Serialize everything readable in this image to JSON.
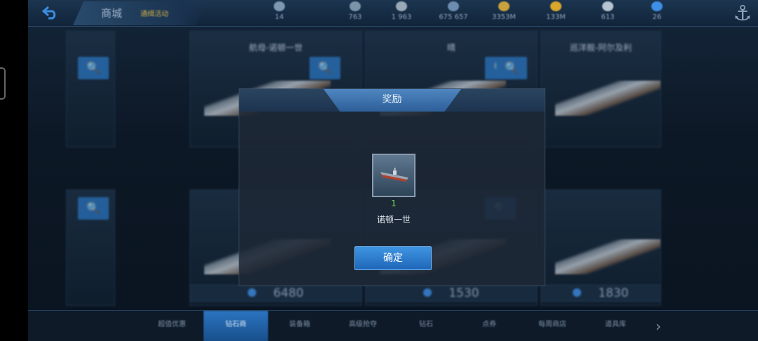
{
  "header": {
    "title": "商城",
    "subtitle": "通缉活动",
    "resources": [
      {
        "icon": "medal-icon",
        "value": "14"
      },
      {
        "icon": "globe-icon",
        "value": "763"
      },
      {
        "icon": "shield-icon",
        "value": "1 963"
      },
      {
        "icon": "gear-icon",
        "value": "675 657"
      },
      {
        "icon": "gold-icon",
        "value": "3353M"
      },
      {
        "icon": "star-icon",
        "value": "133M"
      },
      {
        "icon": "diamond-icon",
        "value": "613"
      },
      {
        "icon": "gem-icon",
        "value": "26"
      }
    ]
  },
  "cards": [
    {
      "name": "航母-诺顿一世"
    },
    {
      "name": "晴"
    },
    {
      "name": "巡洋舰-阿尔及利"
    }
  ],
  "prices": [
    "6480",
    "1530",
    "1830"
  ],
  "tabs": [
    "超值优惠",
    "钻石商",
    "装备箱",
    "高级抢夺",
    "钻石",
    "点券",
    "每周商店",
    "道具库"
  ],
  "modal": {
    "title": "奖励",
    "reward_count": "1",
    "reward_name": "诺顿一世",
    "confirm_label": "确定"
  },
  "colors": {
    "accent": "#2f7fd0",
    "reward_count": "#6fd651"
  }
}
